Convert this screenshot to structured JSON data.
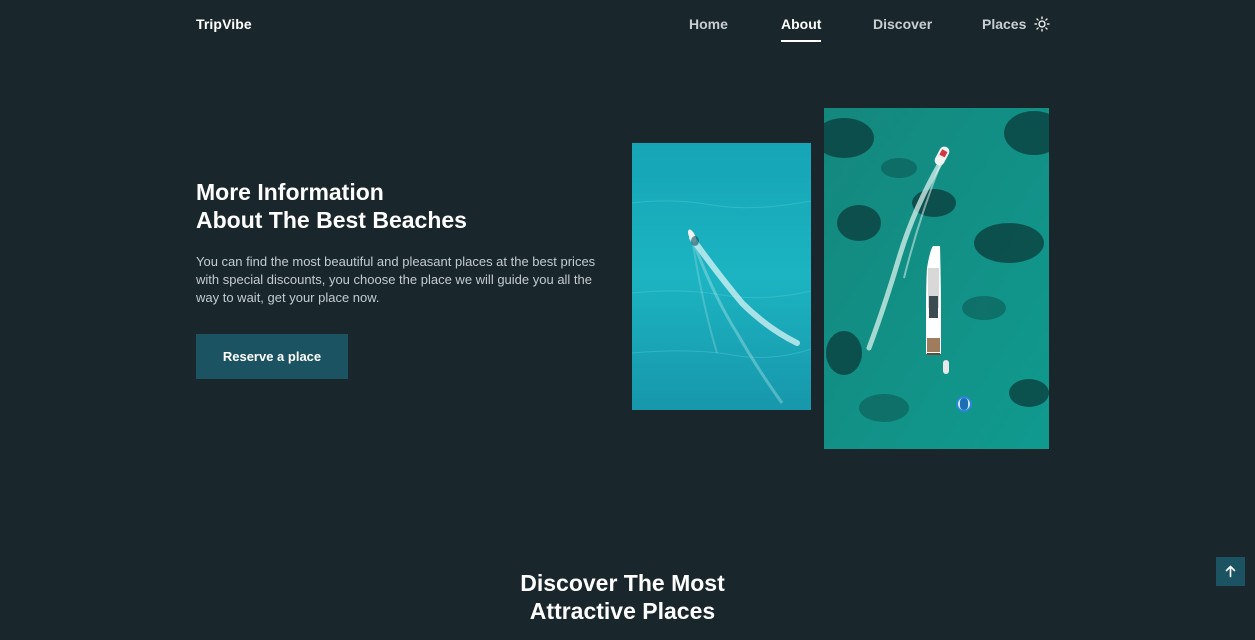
{
  "header": {
    "logo": "TripVibe",
    "nav": [
      {
        "label": "Home",
        "active": false
      },
      {
        "label": "About",
        "active": true
      },
      {
        "label": "Discover",
        "active": false
      },
      {
        "label": "Places",
        "active": false
      }
    ],
    "theme_icon": "sun-icon"
  },
  "about": {
    "title_line1": "More Information",
    "title_line2": "About The Best Beaches",
    "description": "You can find the most beautiful and pleasant places at the best prices with special discounts, you choose the place we will guide you all the way to wait, get your place now.",
    "button_label": "Reserve a place",
    "images": [
      {
        "subject": "aerial view of a small speedboat on turquoise water"
      },
      {
        "subject": "aerial view of a yacht and speedboat on green sea"
      }
    ]
  },
  "discover": {
    "title_line1": "Discover The Most",
    "title_line2": "Attractive Places"
  },
  "scroll_top": {
    "icon": "arrow-up-icon"
  },
  "colors": {
    "background": "#19262b",
    "button": "#1b5362",
    "text_primary": "#ffffff",
    "text_secondary": "#c3ccd0"
  }
}
